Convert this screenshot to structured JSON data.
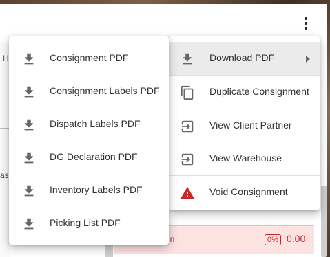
{
  "background": {
    "left_panel_letter": "H",
    "left_panel_fragment": "as",
    "alert_text": "in",
    "alert_badge": "0%",
    "alert_amount": "0.00"
  },
  "colors": {
    "warning_red": "#c62828",
    "active_item_bg": "#ebebeb"
  },
  "main_menu": {
    "items": [
      {
        "label": "Download PDF",
        "icon": "download-icon"
      },
      {
        "label": "Duplicate Consignment",
        "icon": "copy-icon"
      },
      {
        "label": "View Client Partner",
        "icon": "open-in-icon"
      },
      {
        "label": "View Warehouse",
        "icon": "open-in-icon"
      },
      {
        "label": "Void Consignment",
        "icon": "warning-icon"
      }
    ]
  },
  "download_submenu": {
    "items": [
      {
        "label": "Consignment PDF",
        "icon": "download-icon"
      },
      {
        "label": "Consignment Labels PDF",
        "icon": "download-icon"
      },
      {
        "label": "Dispatch Labels PDF",
        "icon": "download-icon"
      },
      {
        "label": "DG Declaration PDF",
        "icon": "download-icon"
      },
      {
        "label": "Inventory Labels PDF",
        "icon": "download-icon"
      },
      {
        "label": "Picking List PDF",
        "icon": "download-icon"
      }
    ]
  }
}
